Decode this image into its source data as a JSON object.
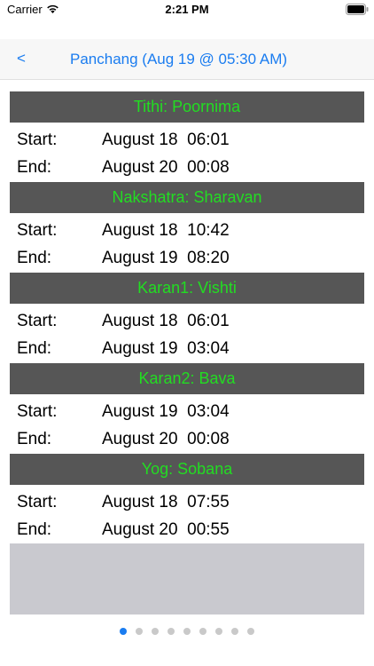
{
  "status_bar": {
    "carrier": "Carrier",
    "time": "2:21 PM"
  },
  "nav": {
    "back_label": "<",
    "title": "Panchang (Aug 19  @ 05:30 AM)"
  },
  "sections": [
    {
      "header": "Tithi: Poornima",
      "rows": [
        {
          "label": "Start:",
          "value": "August 18  06:01"
        },
        {
          "label": "End:",
          "value": "August 20  00:08"
        }
      ]
    },
    {
      "header": "Nakshatra: Sharavan",
      "rows": [
        {
          "label": "Start:",
          "value": "August 18  10:42"
        },
        {
          "label": "End:",
          "value": "August 19  08:20"
        }
      ]
    },
    {
      "header": "Karan1: Vishti",
      "rows": [
        {
          "label": "Start:",
          "value": "August 18  06:01"
        },
        {
          "label": "End:",
          "value": "August 19  03:04"
        }
      ]
    },
    {
      "header": "Karan2: Bava",
      "rows": [
        {
          "label": "Start:",
          "value": "August 19  03:04"
        },
        {
          "label": "End:",
          "value": "August 20  00:08"
        }
      ]
    },
    {
      "header": "Yog: Sobana",
      "rows": [
        {
          "label": "Start:",
          "value": "August 18  07:55"
        },
        {
          "label": "End:",
          "value": "August 20  00:55"
        }
      ]
    }
  ],
  "pager": {
    "count": 9,
    "active_index": 0
  },
  "colors": {
    "accent": "#1a7cf0",
    "header_bg": "#565656",
    "header_text": "#22dd22",
    "footer_box": "#c9c9cf"
  }
}
